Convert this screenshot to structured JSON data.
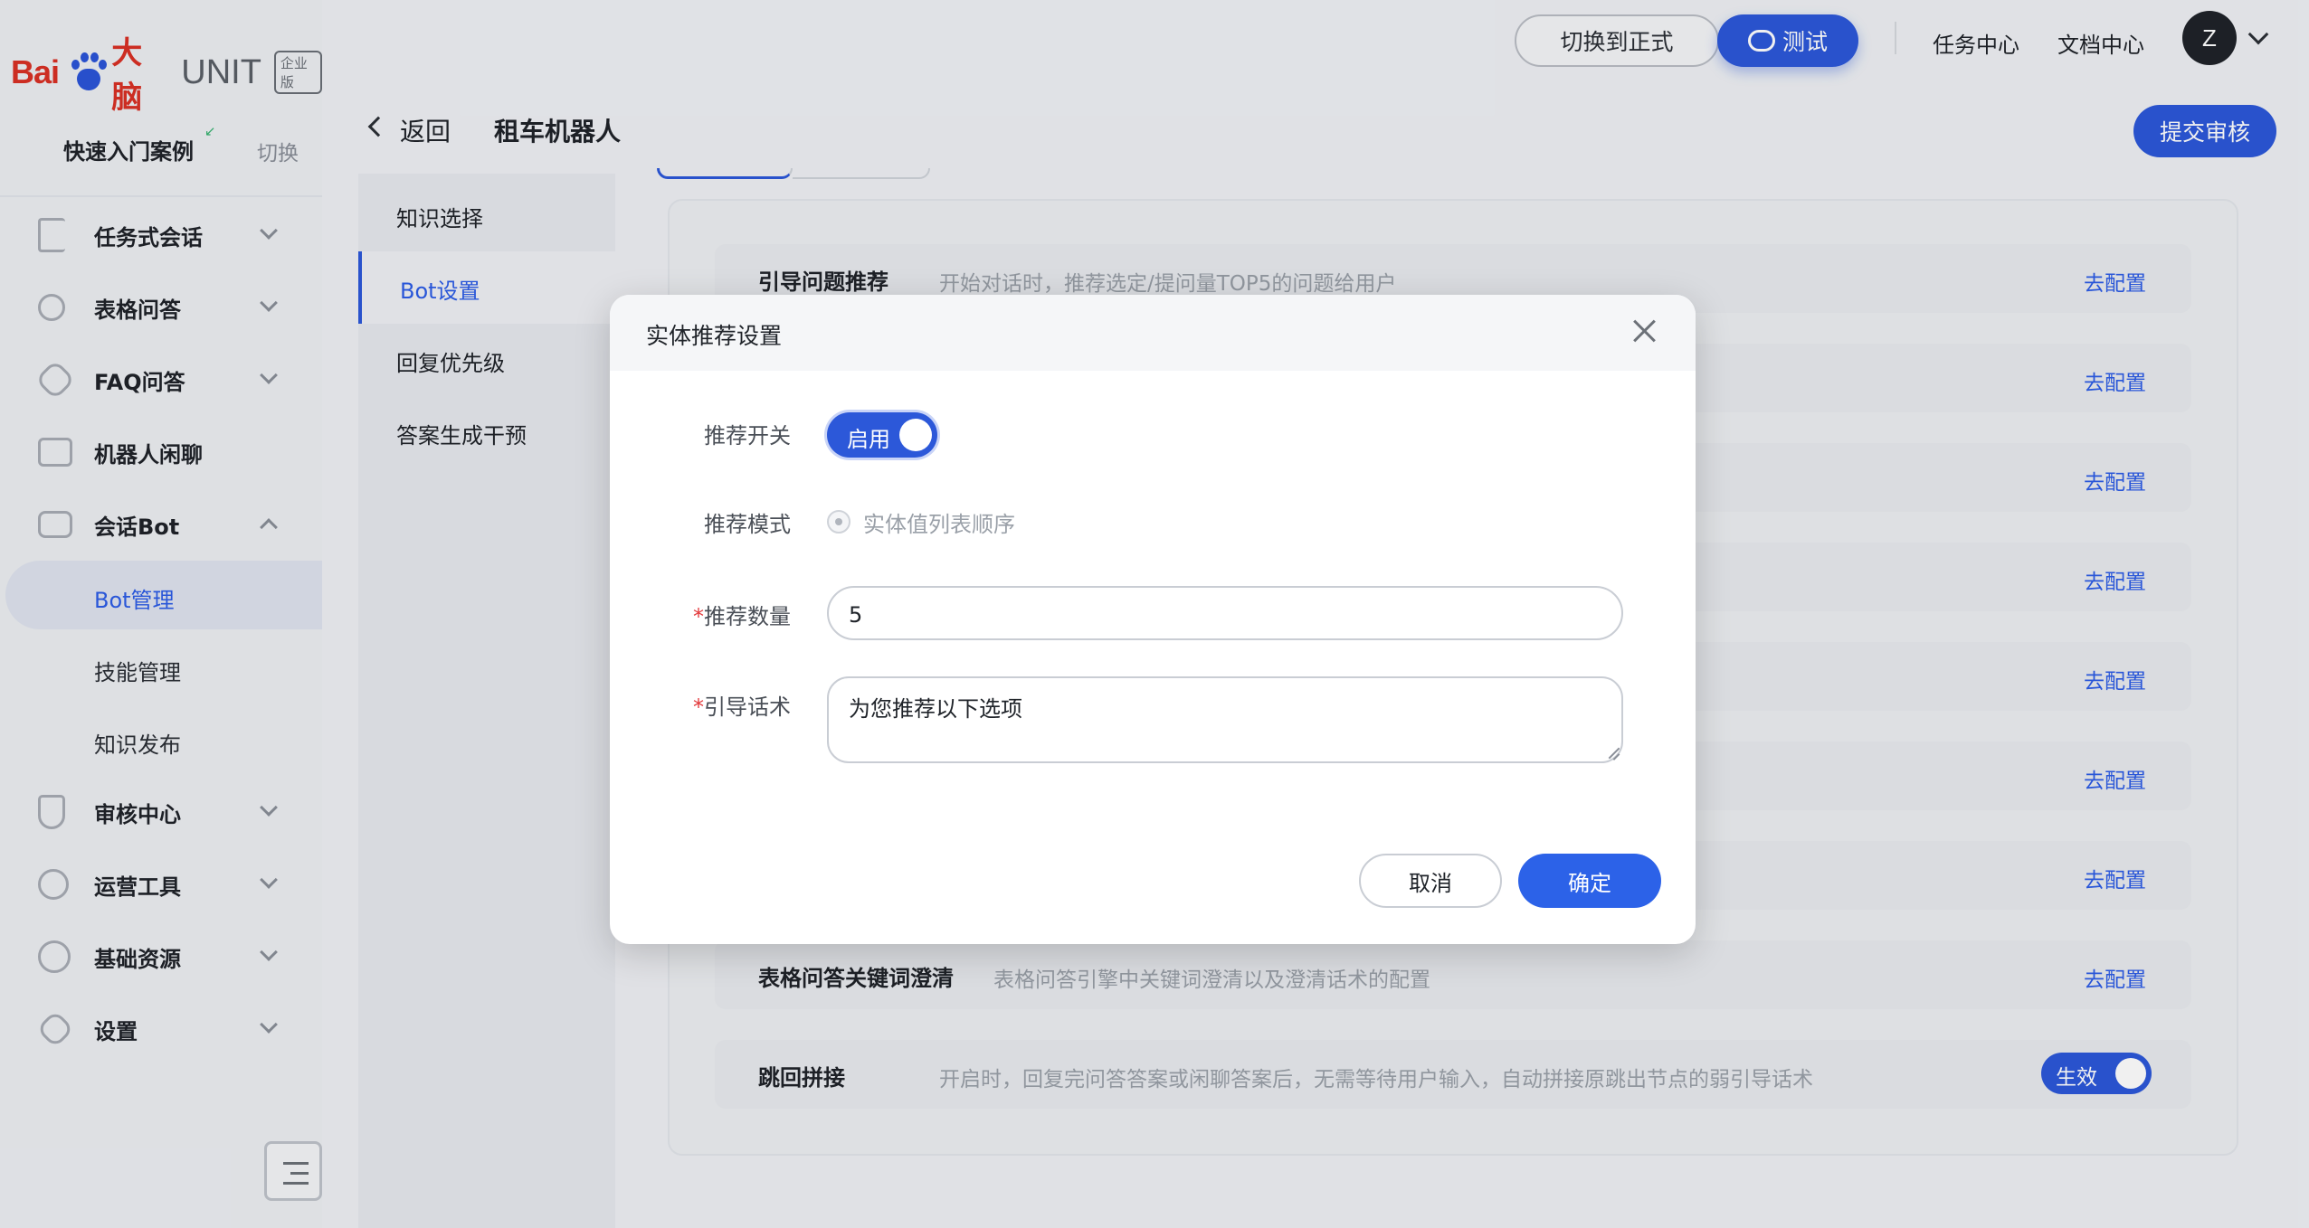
{
  "brand": {
    "logo_bai": "Bai",
    "logo_du": "du",
    "logo_danao": "大脑",
    "logo_unit": "UNIT",
    "edition": "企业版"
  },
  "sidebar": {
    "case_label": "快速入门案例",
    "switch_label": "切换",
    "items": [
      {
        "label": "任务式会话",
        "icon": "flow-icon",
        "expanded": false
      },
      {
        "label": "表格问答",
        "icon": "table-qa-icon",
        "expanded": false
      },
      {
        "label": "FAQ问答",
        "icon": "faq-icon",
        "expanded": false
      },
      {
        "label": "机器人闲聊",
        "icon": "chat-icon",
        "expanded": false
      },
      {
        "label": "会话Bot",
        "icon": "bot-icon",
        "expanded": true,
        "children": [
          {
            "label": "Bot管理",
            "active": true
          },
          {
            "label": "技能管理",
            "active": false
          },
          {
            "label": "知识发布",
            "active": false
          }
        ]
      },
      {
        "label": "审核中心",
        "icon": "shield-icon",
        "expanded": false
      },
      {
        "label": "运营工具",
        "icon": "tools-icon",
        "expanded": false
      },
      {
        "label": "基础资源",
        "icon": "resource-icon",
        "expanded": false
      },
      {
        "label": "设置",
        "icon": "gear-icon",
        "expanded": false
      }
    ]
  },
  "topbar": {
    "switch_formal": "切换到正式",
    "test": "测试",
    "task_center": "任务中心",
    "doc_center": "文档中心",
    "avatar_letter": "Z"
  },
  "header": {
    "back": "返回",
    "bot_name": "租车机器人",
    "submit": "提交审核"
  },
  "subnav": {
    "items": [
      "知识选择",
      "Bot设置",
      "回复优先级",
      "答案生成干预"
    ],
    "active_index": 1
  },
  "config_rows": [
    {
      "title": "引导问题推荐",
      "desc": "开始对话时，推荐选定/提问量TOP5的问题给用户",
      "action": "去配置"
    },
    {
      "title": "",
      "desc": "",
      "action": "去配置"
    },
    {
      "title": "",
      "desc": "",
      "action": "去配置"
    },
    {
      "title": "",
      "desc": "",
      "action": "去配置"
    },
    {
      "title": "",
      "desc": "",
      "action": "去配置"
    },
    {
      "title": "",
      "desc": "",
      "action": "去配置"
    },
    {
      "title": "",
      "desc": "",
      "action": "去配置"
    },
    {
      "title": "表格问答关键词澄清",
      "desc": "表格问答引擎中关键词澄清以及澄清话术的配置",
      "action": "去配置"
    },
    {
      "title": "跳回拼接",
      "desc": "开启时，回复完问答答案或闲聊答案后，无需等待用户输入，自动拼接原跳出节点的弱引导话术",
      "toggle": "生效"
    }
  ],
  "modal": {
    "title": "实体推荐设置",
    "switch_label": "推荐开关",
    "switch_state": "启用",
    "mode_label": "推荐模式",
    "mode_option": "实体值列表顺序",
    "count_label": "推荐数量",
    "count_value": "5",
    "guide_label": "引导话术",
    "guide_value": "为您推荐以下选项",
    "required_mark": "*",
    "cancel": "取消",
    "ok": "确定"
  },
  "colors": {
    "accent": "#2c58d9",
    "link": "#2c5ce6",
    "required": "#e2393b"
  }
}
